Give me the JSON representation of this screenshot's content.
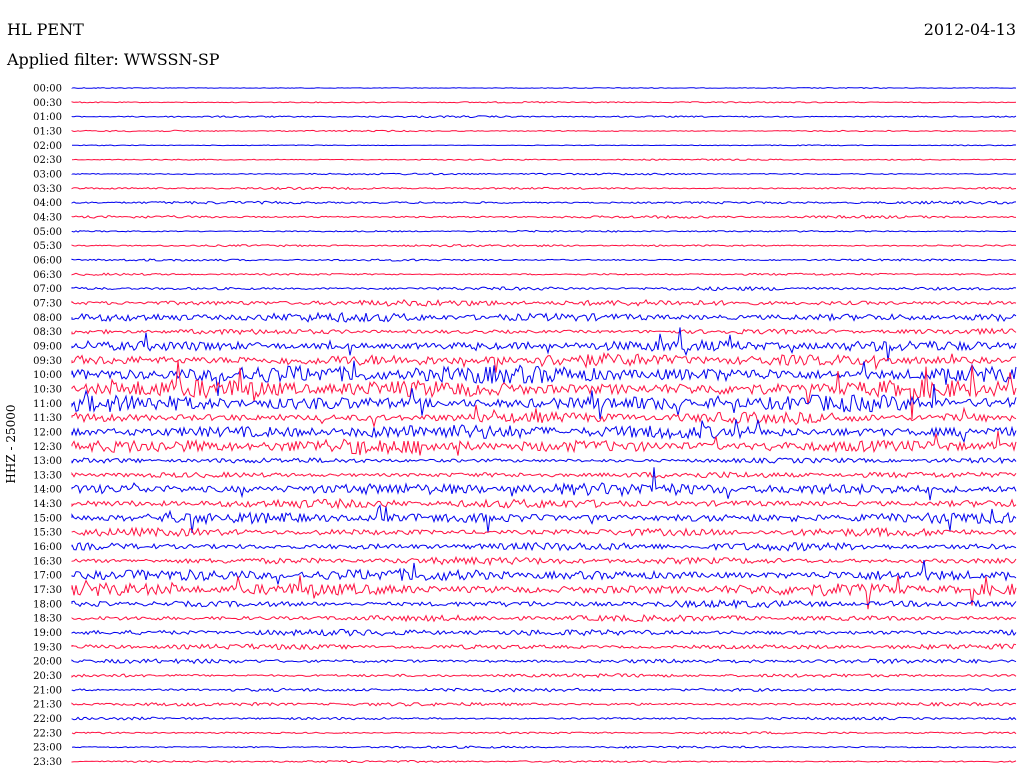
{
  "header": {
    "station": "HL PENT",
    "date": "2012-04-13",
    "filter": "Applied filter: WWSSN-SP"
  },
  "colors": {
    "even": "#0000ee",
    "odd": "#ff1040",
    "text": "#000000"
  },
  "chart_data": {
    "type": "line",
    "title": "",
    "xlabel": "",
    "ylabel": "HHZ - 25000",
    "rows": [
      {
        "time": "00:00",
        "activity": 0.05
      },
      {
        "time": "00:30",
        "activity": 0.08
      },
      {
        "time": "01:00",
        "activity": 0.1
      },
      {
        "time": "01:30",
        "activity": 0.08
      },
      {
        "time": "02:00",
        "activity": 0.05
      },
      {
        "time": "02:30",
        "activity": 0.08
      },
      {
        "time": "03:00",
        "activity": 0.1
      },
      {
        "time": "03:30",
        "activity": 0.12
      },
      {
        "time": "04:00",
        "activity": 0.15
      },
      {
        "time": "04:30",
        "activity": 0.15
      },
      {
        "time": "05:00",
        "activity": 0.1
      },
      {
        "time": "05:30",
        "activity": 0.12
      },
      {
        "time": "06:00",
        "activity": 0.12
      },
      {
        "time": "06:30",
        "activity": 0.12
      },
      {
        "time": "07:00",
        "activity": 0.2
      },
      {
        "time": "07:30",
        "activity": 0.35
      },
      {
        "time": "08:00",
        "activity": 0.5
      },
      {
        "time": "08:30",
        "activity": 0.3
      },
      {
        "time": "09:00",
        "activity": 0.6
      },
      {
        "time": "09:30",
        "activity": 0.7
      },
      {
        "time": "10:00",
        "activity": 1.0
      },
      {
        "time": "10:30",
        "activity": 1.0
      },
      {
        "time": "11:00",
        "activity": 0.9
      },
      {
        "time": "11:30",
        "activity": 0.6
      },
      {
        "time": "12:00",
        "activity": 0.8
      },
      {
        "time": "12:30",
        "activity": 0.8
      },
      {
        "time": "13:00",
        "activity": 0.3
      },
      {
        "time": "13:30",
        "activity": 0.35
      },
      {
        "time": "14:00",
        "activity": 0.7
      },
      {
        "time": "14:30",
        "activity": 0.5
      },
      {
        "time": "15:00",
        "activity": 0.6
      },
      {
        "time": "15:30",
        "activity": 0.45
      },
      {
        "time": "16:00",
        "activity": 0.45
      },
      {
        "time": "16:30",
        "activity": 0.4
      },
      {
        "time": "17:00",
        "activity": 0.65
      },
      {
        "time": "17:30",
        "activity": 0.7
      },
      {
        "time": "18:00",
        "activity": 0.4
      },
      {
        "time": "18:30",
        "activity": 0.35
      },
      {
        "time": "19:00",
        "activity": 0.35
      },
      {
        "time": "19:30",
        "activity": 0.3
      },
      {
        "time": "20:00",
        "activity": 0.25
      },
      {
        "time": "20:30",
        "activity": 0.2
      },
      {
        "time": "21:00",
        "activity": 0.2
      },
      {
        "time": "21:30",
        "activity": 0.2
      },
      {
        "time": "22:00",
        "activity": 0.15
      },
      {
        "time": "22:30",
        "activity": 0.12
      },
      {
        "time": "23:00",
        "activity": 0.12
      },
      {
        "time": "23:30",
        "activity": 0.12
      }
    ]
  }
}
